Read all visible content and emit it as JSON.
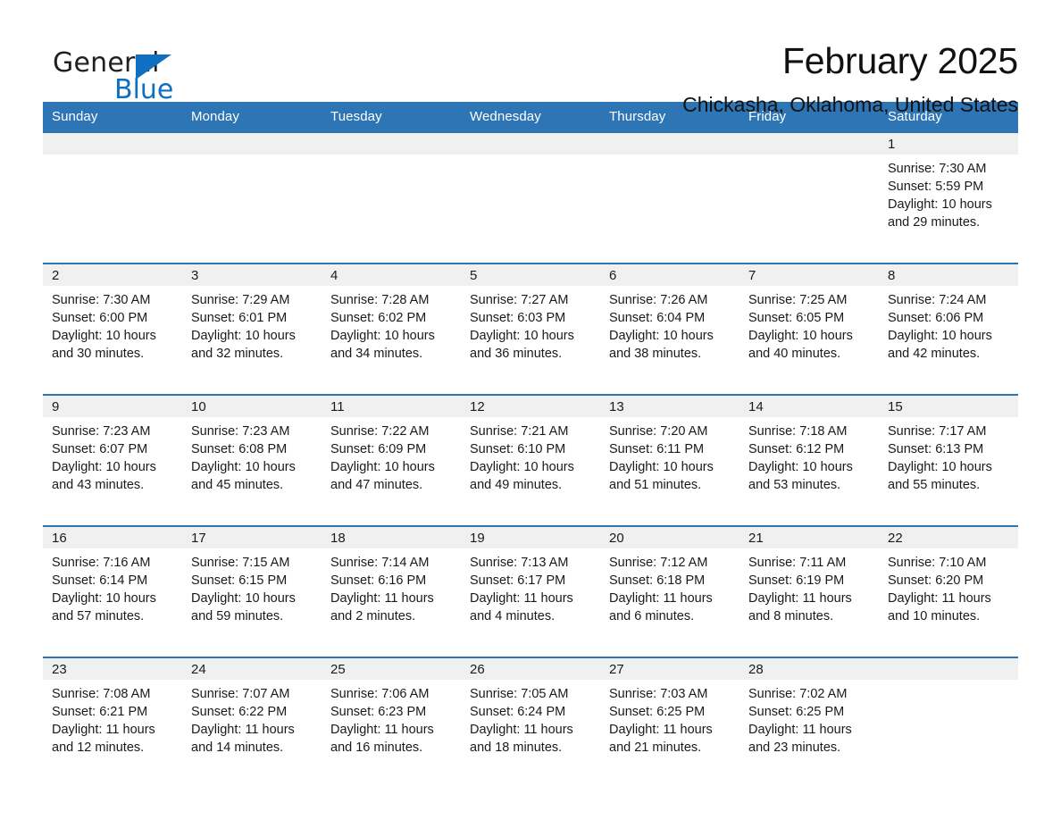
{
  "logo": {
    "word1": "General",
    "word2": "Blue",
    "triangle_color": "#0f6fc0"
  },
  "header": {
    "month_title": "February 2025",
    "location": "Chickasha, Oklahoma, United States"
  },
  "theme": {
    "header_blue": "#2e75b6",
    "daynum_band": "#f0f0f0",
    "text": "#1a1a1a"
  },
  "calendar": {
    "weekday_headers": [
      "Sunday",
      "Monday",
      "Tuesday",
      "Wednesday",
      "Thursday",
      "Friday",
      "Saturday"
    ],
    "labels": {
      "sunrise": "Sunrise:",
      "sunset": "Sunset:",
      "daylight": "Daylight:"
    },
    "weeks": [
      [
        {
          "day": "",
          "empty": true
        },
        {
          "day": "",
          "empty": true
        },
        {
          "day": "",
          "empty": true
        },
        {
          "day": "",
          "empty": true
        },
        {
          "day": "",
          "empty": true
        },
        {
          "day": "",
          "empty": true
        },
        {
          "day": "1",
          "sunrise": "Sunrise: 7:30 AM",
          "sunset": "Sunset: 5:59 PM",
          "daylight_1": "Daylight: 10 hours",
          "daylight_2": "and 29 minutes."
        }
      ],
      [
        {
          "day": "2",
          "sunrise": "Sunrise: 7:30 AM",
          "sunset": "Sunset: 6:00 PM",
          "daylight_1": "Daylight: 10 hours",
          "daylight_2": "and 30 minutes."
        },
        {
          "day": "3",
          "sunrise": "Sunrise: 7:29 AM",
          "sunset": "Sunset: 6:01 PM",
          "daylight_1": "Daylight: 10 hours",
          "daylight_2": "and 32 minutes."
        },
        {
          "day": "4",
          "sunrise": "Sunrise: 7:28 AM",
          "sunset": "Sunset: 6:02 PM",
          "daylight_1": "Daylight: 10 hours",
          "daylight_2": "and 34 minutes."
        },
        {
          "day": "5",
          "sunrise": "Sunrise: 7:27 AM",
          "sunset": "Sunset: 6:03 PM",
          "daylight_1": "Daylight: 10 hours",
          "daylight_2": "and 36 minutes."
        },
        {
          "day": "6",
          "sunrise": "Sunrise: 7:26 AM",
          "sunset": "Sunset: 6:04 PM",
          "daylight_1": "Daylight: 10 hours",
          "daylight_2": "and 38 minutes."
        },
        {
          "day": "7",
          "sunrise": "Sunrise: 7:25 AM",
          "sunset": "Sunset: 6:05 PM",
          "daylight_1": "Daylight: 10 hours",
          "daylight_2": "and 40 minutes."
        },
        {
          "day": "8",
          "sunrise": "Sunrise: 7:24 AM",
          "sunset": "Sunset: 6:06 PM",
          "daylight_1": "Daylight: 10 hours",
          "daylight_2": "and 42 minutes."
        }
      ],
      [
        {
          "day": "9",
          "sunrise": "Sunrise: 7:23 AM",
          "sunset": "Sunset: 6:07 PM",
          "daylight_1": "Daylight: 10 hours",
          "daylight_2": "and 43 minutes."
        },
        {
          "day": "10",
          "sunrise": "Sunrise: 7:23 AM",
          "sunset": "Sunset: 6:08 PM",
          "daylight_1": "Daylight: 10 hours",
          "daylight_2": "and 45 minutes."
        },
        {
          "day": "11",
          "sunrise": "Sunrise: 7:22 AM",
          "sunset": "Sunset: 6:09 PM",
          "daylight_1": "Daylight: 10 hours",
          "daylight_2": "and 47 minutes."
        },
        {
          "day": "12",
          "sunrise": "Sunrise: 7:21 AM",
          "sunset": "Sunset: 6:10 PM",
          "daylight_1": "Daylight: 10 hours",
          "daylight_2": "and 49 minutes."
        },
        {
          "day": "13",
          "sunrise": "Sunrise: 7:20 AM",
          "sunset": "Sunset: 6:11 PM",
          "daylight_1": "Daylight: 10 hours",
          "daylight_2": "and 51 minutes."
        },
        {
          "day": "14",
          "sunrise": "Sunrise: 7:18 AM",
          "sunset": "Sunset: 6:12 PM",
          "daylight_1": "Daylight: 10 hours",
          "daylight_2": "and 53 minutes."
        },
        {
          "day": "15",
          "sunrise": "Sunrise: 7:17 AM",
          "sunset": "Sunset: 6:13 PM",
          "daylight_1": "Daylight: 10 hours",
          "daylight_2": "and 55 minutes."
        }
      ],
      [
        {
          "day": "16",
          "sunrise": "Sunrise: 7:16 AM",
          "sunset": "Sunset: 6:14 PM",
          "daylight_1": "Daylight: 10 hours",
          "daylight_2": "and 57 minutes."
        },
        {
          "day": "17",
          "sunrise": "Sunrise: 7:15 AM",
          "sunset": "Sunset: 6:15 PM",
          "daylight_1": "Daylight: 10 hours",
          "daylight_2": "and 59 minutes."
        },
        {
          "day": "18",
          "sunrise": "Sunrise: 7:14 AM",
          "sunset": "Sunset: 6:16 PM",
          "daylight_1": "Daylight: 11 hours",
          "daylight_2": "and 2 minutes."
        },
        {
          "day": "19",
          "sunrise": "Sunrise: 7:13 AM",
          "sunset": "Sunset: 6:17 PM",
          "daylight_1": "Daylight: 11 hours",
          "daylight_2": "and 4 minutes."
        },
        {
          "day": "20",
          "sunrise": "Sunrise: 7:12 AM",
          "sunset": "Sunset: 6:18 PM",
          "daylight_1": "Daylight: 11 hours",
          "daylight_2": "and 6 minutes."
        },
        {
          "day": "21",
          "sunrise": "Sunrise: 7:11 AM",
          "sunset": "Sunset: 6:19 PM",
          "daylight_1": "Daylight: 11 hours",
          "daylight_2": "and 8 minutes."
        },
        {
          "day": "22",
          "sunrise": "Sunrise: 7:10 AM",
          "sunset": "Sunset: 6:20 PM",
          "daylight_1": "Daylight: 11 hours",
          "daylight_2": "and 10 minutes."
        }
      ],
      [
        {
          "day": "23",
          "sunrise": "Sunrise: 7:08 AM",
          "sunset": "Sunset: 6:21 PM",
          "daylight_1": "Daylight: 11 hours",
          "daylight_2": "and 12 minutes."
        },
        {
          "day": "24",
          "sunrise": "Sunrise: 7:07 AM",
          "sunset": "Sunset: 6:22 PM",
          "daylight_1": "Daylight: 11 hours",
          "daylight_2": "and 14 minutes."
        },
        {
          "day": "25",
          "sunrise": "Sunrise: 7:06 AM",
          "sunset": "Sunset: 6:23 PM",
          "daylight_1": "Daylight: 11 hours",
          "daylight_2": "and 16 minutes."
        },
        {
          "day": "26",
          "sunrise": "Sunrise: 7:05 AM",
          "sunset": "Sunset: 6:24 PM",
          "daylight_1": "Daylight: 11 hours",
          "daylight_2": "and 18 minutes."
        },
        {
          "day": "27",
          "sunrise": "Sunrise: 7:03 AM",
          "sunset": "Sunset: 6:25 PM",
          "daylight_1": "Daylight: 11 hours",
          "daylight_2": "and 21 minutes."
        },
        {
          "day": "28",
          "sunrise": "Sunrise: 7:02 AM",
          "sunset": "Sunset: 6:25 PM",
          "daylight_1": "Daylight: 11 hours",
          "daylight_2": "and 23 minutes."
        },
        {
          "day": "",
          "empty": true
        }
      ]
    ]
  }
}
